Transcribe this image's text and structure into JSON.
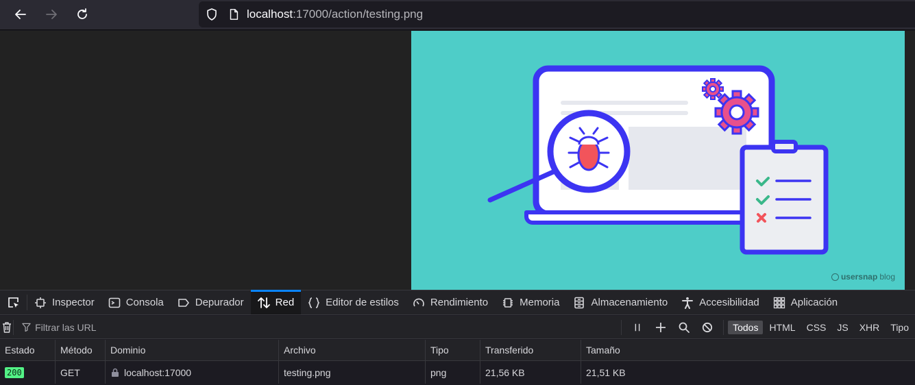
{
  "browser": {
    "url_host": "localhost",
    "url_rest": ":17000/action/testing.png"
  },
  "image": {
    "watermark_brand": "usersnap",
    "watermark_suffix": "blog",
    "colors": {
      "background": "#4ecdc8",
      "outline": "#3c34f2",
      "bug": "#f2545b",
      "gear": "#e8508c",
      "check": "#3ab88a"
    }
  },
  "devtools": {
    "tabs": [
      {
        "label": "Inspector",
        "icon": "inspector-icon"
      },
      {
        "label": "Consola",
        "icon": "console-icon"
      },
      {
        "label": "Depurador",
        "icon": "debugger-icon"
      },
      {
        "label": "Red",
        "icon": "network-icon",
        "active": true
      },
      {
        "label": "Editor de estilos",
        "icon": "style-editor-icon"
      },
      {
        "label": "Rendimiento",
        "icon": "performance-icon"
      },
      {
        "label": "Memoria",
        "icon": "memory-icon"
      },
      {
        "label": "Almacenamiento",
        "icon": "storage-icon"
      },
      {
        "label": "Accesibilidad",
        "icon": "accessibility-icon"
      },
      {
        "label": "Aplicación",
        "icon": "application-icon"
      }
    ],
    "filter_placeholder": "Filtrar las URL",
    "filter_types": [
      "Todos",
      "HTML",
      "CSS",
      "JS",
      "XHR",
      "Tipo"
    ],
    "active_filter": "Todos",
    "columns": [
      "Estado",
      "Método",
      "Dominio",
      "Archivo",
      "Tipo",
      "Transferido",
      "Tamaño"
    ],
    "rows": [
      {
        "estado": "200",
        "metodo": "GET",
        "dominio": "localhost:17000",
        "archivo": "testing.png",
        "tipo": "png",
        "transferido": "21,56 KB",
        "tamano": "21,51 KB"
      }
    ]
  }
}
